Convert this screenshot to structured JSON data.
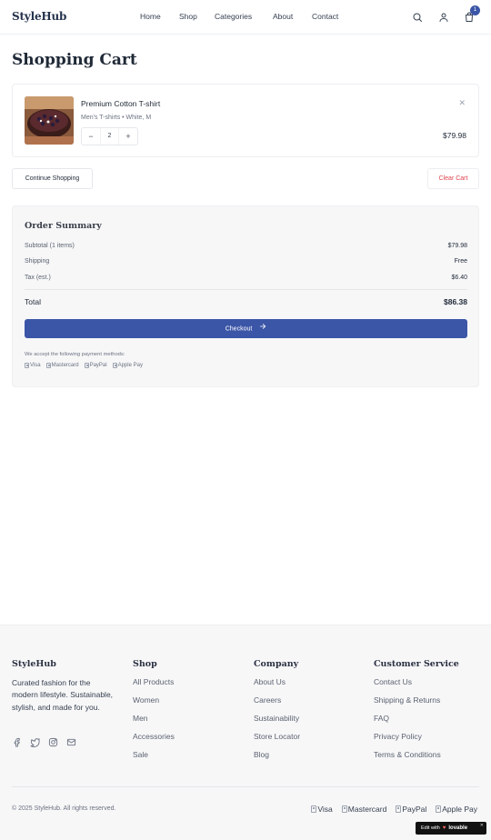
{
  "header": {
    "logo": "StyleHub",
    "nav": [
      "Home",
      "Shop",
      "Categories",
      "About",
      "Contact"
    ],
    "cart_count": "1"
  },
  "page": {
    "title": "Shopping Cart"
  },
  "cart": {
    "item": {
      "name": "Premium Cotton T-shirt",
      "variant": "Men's T-shirts • White, M",
      "quantity": "2",
      "price": "$79.98",
      "minus": "−",
      "plus": "+",
      "remove": "✕"
    },
    "continue_label": "Continue Shopping",
    "clear_label": "Clear Cart"
  },
  "summary": {
    "title": "Order Summary",
    "subtotal_label": "Subtotal (1 items)",
    "subtotal_value": "$79.98",
    "shipping_label": "Shipping",
    "shipping_value": "Free",
    "tax_label": "Tax (est.)",
    "tax_value": "$6.40",
    "total_label": "Total",
    "total_value": "$86.38",
    "checkout_label": "Checkout",
    "payment_note": "We accept the following payment methods:",
    "payment_methods": [
      "Visa",
      "Mastercard",
      "PayPal",
      "Apple Pay"
    ]
  },
  "footer": {
    "brand": "StyleHub",
    "tagline": "Curated fashion for the modern lifestyle. Sustainable, stylish, and made for you.",
    "shop_title": "Shop",
    "shop_links": [
      "All Products",
      "Women",
      "Men",
      "Accessories",
      "Sale"
    ],
    "company_title": "Company",
    "company_links": [
      "About Us",
      "Careers",
      "Sustainability",
      "Store Locator",
      "Blog"
    ],
    "service_title": "Customer Service",
    "service_links": [
      "Contact Us",
      "Shipping & Returns",
      "FAQ",
      "Privacy Policy",
      "Terms & Conditions"
    ],
    "copyright": "© 2025 StyleHub. All rights reserved.",
    "payment_methods": [
      "Visa",
      "Mastercard",
      "PayPal",
      "Apple Pay"
    ]
  },
  "badge": {
    "edit_with": "Edit with",
    "brand": "lovable",
    "close": "✕"
  },
  "colors": {
    "primary": "#3b55a7",
    "danger": "#e0454f",
    "muted": "#6b7280"
  }
}
